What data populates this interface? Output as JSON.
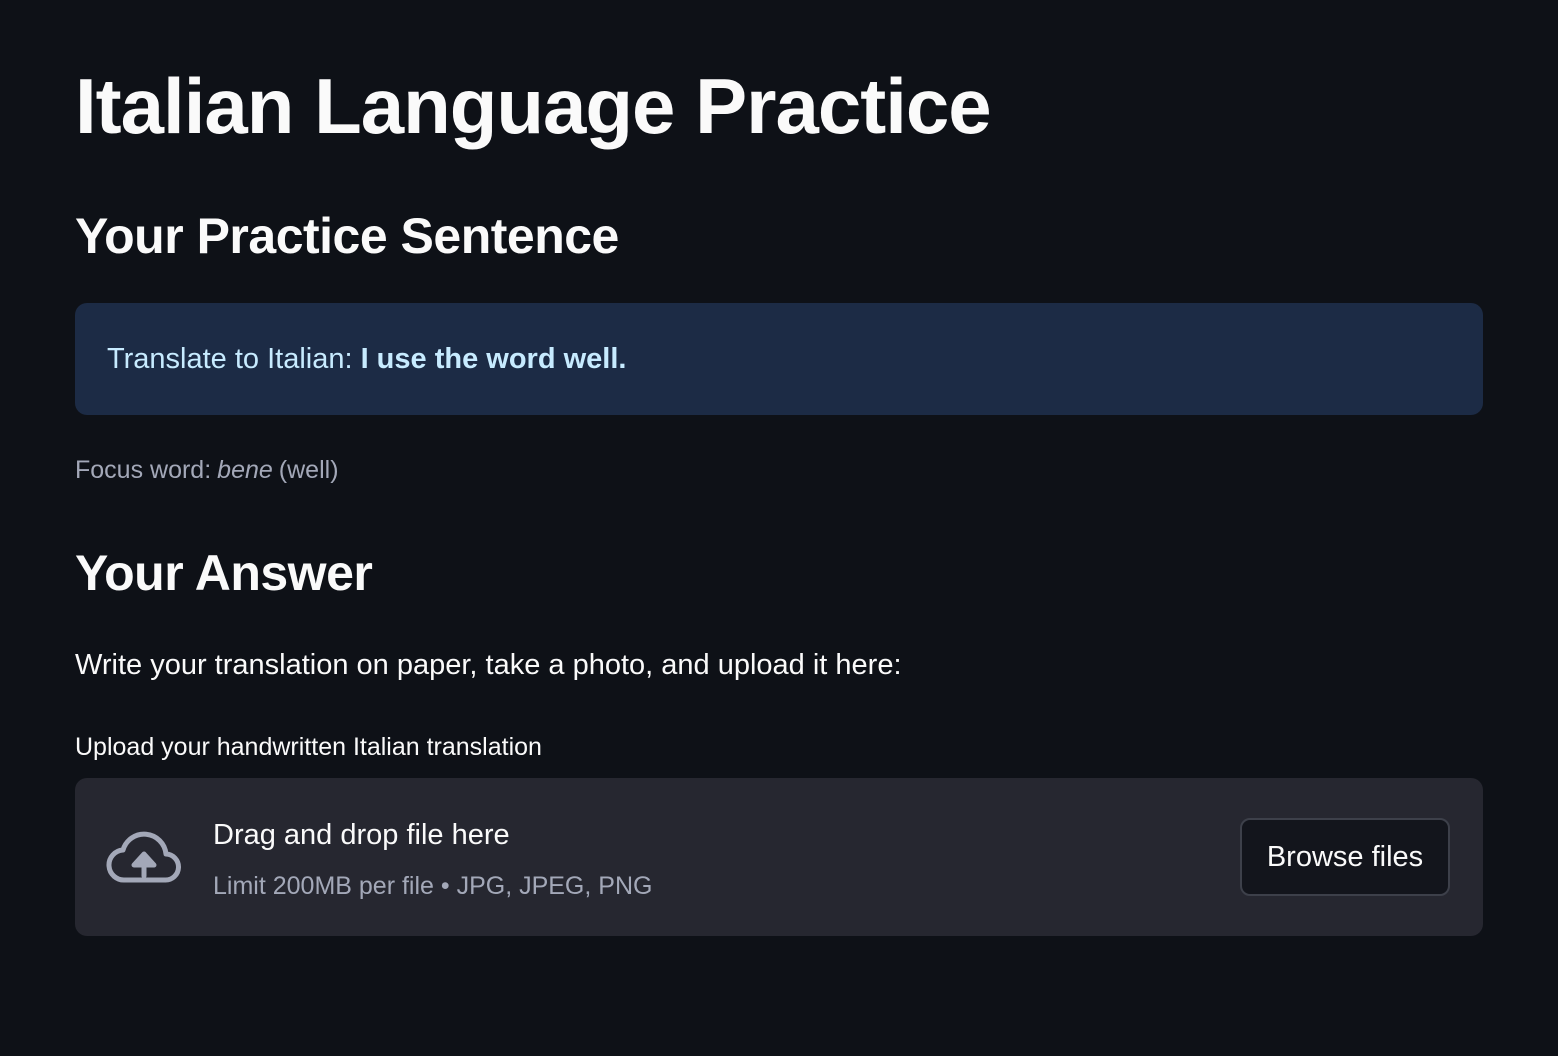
{
  "page": {
    "title": "Italian Language Practice"
  },
  "practice": {
    "heading": "Your Practice Sentence",
    "prompt_prefix": "Translate to Italian:",
    "prompt_sentence": "I use the word well.",
    "focus_prefix": "Focus word:",
    "focus_word": "bene",
    "focus_meaning": "(well)"
  },
  "answer": {
    "heading": "Your Answer",
    "instructions": "Write your translation on paper, take a photo, and upload it here:"
  },
  "uploader": {
    "label": "Upload your handwritten Italian translation",
    "drop_text": "Drag and drop file here",
    "limit_text": "Limit 200MB per file • JPG, JPEG, PNG",
    "browse_label": "Browse files",
    "icon": "cloud-upload-icon"
  },
  "colors": {
    "background": "#0e1117",
    "info_background": "#1c2b45",
    "info_text": "#c7ebff",
    "dropzone_background": "#262730",
    "muted_text": "#a3a8b8"
  }
}
